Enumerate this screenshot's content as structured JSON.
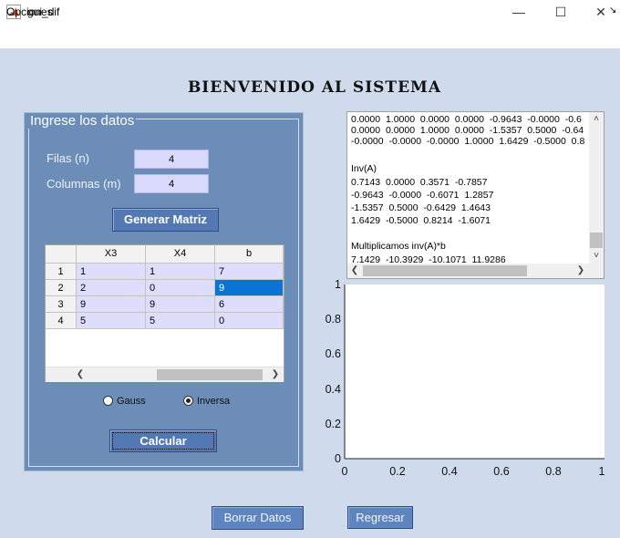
{
  "window": {
    "title": "gui_dif",
    "minimize_glyph": "—",
    "maximize_glyph": "☐",
    "close_glyph": "✕"
  },
  "menu": {
    "items": [
      "Opciones"
    ],
    "arrow": "↘"
  },
  "heading": "Bienvenido al Sistema",
  "panel": {
    "title": "Ingrese los datos",
    "filas_label": "Filas (n)",
    "filas_value": "4",
    "columnas_label": "Columnas (m)",
    "columnas_value": "4",
    "generar_label": "Generar Matriz",
    "calcular_label": "Calcular"
  },
  "table": {
    "columns": [
      "X3",
      "X4",
      "b"
    ],
    "rows": [
      {
        "header": "1",
        "cells": [
          "1",
          "1",
          "7"
        ]
      },
      {
        "header": "2",
        "cells": [
          "2",
          "0",
          "9"
        ]
      },
      {
        "header": "3",
        "cells": [
          "9",
          "9",
          "6"
        ]
      },
      {
        "header": "4",
        "cells": [
          "5",
          "5",
          "0"
        ]
      }
    ],
    "selected_cell": {
      "row": 1,
      "col": 2
    }
  },
  "method": {
    "options": [
      "Gauss",
      "Inversa"
    ],
    "selected": "Inversa"
  },
  "output_lines": [
    "0.0000  1.0000  0.0000  0.0000  -0.9643  -0.0000  -0.6",
    "0.0000  0.0000  1.0000  0.0000  -1.5357  0.5000  -0.64",
    "-0.0000  -0.0000  -0.0000  1.0000  1.6429  -0.5000  0.8",
    "",
    "Inv(A)",
    "0.7143  0.0000  0.3571  -0.7857",
    "-0.9643  -0.0000  -0.6071  1.2857",
    "-1.5357  0.5000  -0.6429  1.4643",
    "1.6429  -0.5000  0.8214  -1.6071",
    "",
    "Multiplicamos inv(A)*b",
    "7.1429  -10.3929  -10.1071  11.9286"
  ],
  "axes": {
    "yticks": [
      "0",
      "0.2",
      "0.4",
      "0.6",
      "0.8",
      "1"
    ],
    "xticks": [
      "0",
      "0.2",
      "0.4",
      "0.6",
      "0.8",
      "1"
    ]
  },
  "buttons": {
    "borrar": "Borrar Datos",
    "regresar": "Regresar"
  },
  "colors": {
    "figure_bg": "#cfdbec",
    "panel_bg": "#6c8db7",
    "button_bg": "#5378b4",
    "selected_cell": "#0a74d6"
  }
}
